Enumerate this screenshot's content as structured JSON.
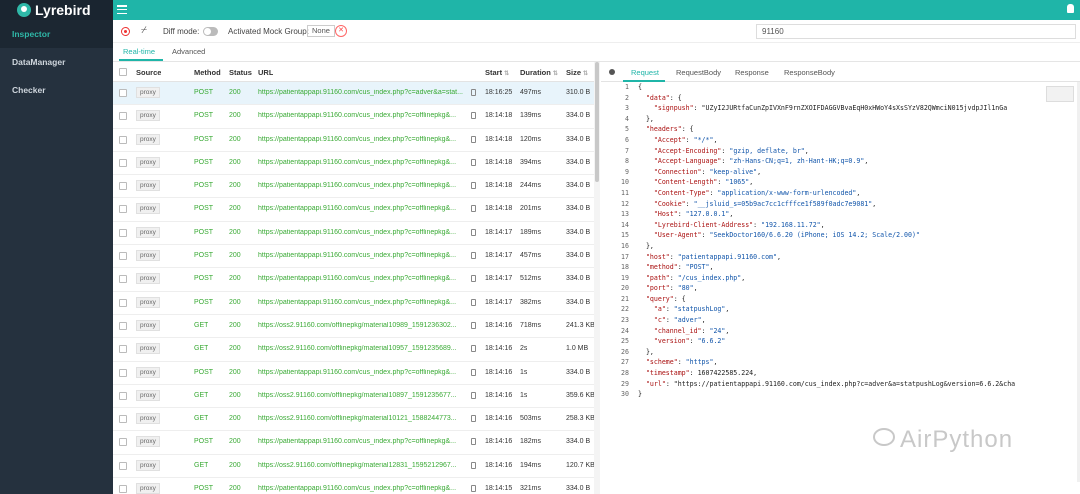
{
  "app": {
    "title": "Lyrebird"
  },
  "sidebar": {
    "items": [
      {
        "label": "Inspector"
      },
      {
        "label": "DataManager"
      },
      {
        "label": "Checker"
      }
    ]
  },
  "toolbar": {
    "diff_label": "Diff mode:",
    "mock_label": "Activated Mock Group:",
    "mock_value": "None",
    "search_value": "91160"
  },
  "tabs": [
    {
      "label": "Real-time"
    },
    {
      "label": "Advanced"
    }
  ],
  "list": {
    "headers": {
      "source": "Source",
      "method": "Method",
      "status": "Status",
      "url": "URL",
      "start": "Start",
      "duration": "Duration",
      "size": "Size"
    },
    "rows": [
      {
        "source": "proxy",
        "method": "POST",
        "status": "200",
        "url": "https://patientappapi.91160.com/cus_index.php?c=adver&a=stat...",
        "start": "18:16:25",
        "duration": "497ms",
        "size": "310.0 B"
      },
      {
        "source": "proxy",
        "method": "POST",
        "status": "200",
        "url": "https://patientappapi.91160.com/cus_index.php?c=offlinepkg&...",
        "start": "18:14:18",
        "duration": "139ms",
        "size": "334.0 B"
      },
      {
        "source": "proxy",
        "method": "POST",
        "status": "200",
        "url": "https://patientappapi.91160.com/cus_index.php?c=offlinepkg&...",
        "start": "18:14:18",
        "duration": "120ms",
        "size": "334.0 B"
      },
      {
        "source": "proxy",
        "method": "POST",
        "status": "200",
        "url": "https://patientappapi.91160.com/cus_index.php?c=offlinepkg&...",
        "start": "18:14:18",
        "duration": "394ms",
        "size": "334.0 B"
      },
      {
        "source": "proxy",
        "method": "POST",
        "status": "200",
        "url": "https://patientappapi.91160.com/cus_index.php?c=offlinepkg&...",
        "start": "18:14:18",
        "duration": "244ms",
        "size": "334.0 B"
      },
      {
        "source": "proxy",
        "method": "POST",
        "status": "200",
        "url": "https://patientappapi.91160.com/cus_index.php?c=offlinepkg&...",
        "start": "18:14:18",
        "duration": "201ms",
        "size": "334.0 B"
      },
      {
        "source": "proxy",
        "method": "POST",
        "status": "200",
        "url": "https://patientappapi.91160.com/cus_index.php?c=offlinepkg&...",
        "start": "18:14:17",
        "duration": "189ms",
        "size": "334.0 B"
      },
      {
        "source": "proxy",
        "method": "POST",
        "status": "200",
        "url": "https://patientappapi.91160.com/cus_index.php?c=offlinepkg&...",
        "start": "18:14:17",
        "duration": "457ms",
        "size": "334.0 B"
      },
      {
        "source": "proxy",
        "method": "POST",
        "status": "200",
        "url": "https://patientappapi.91160.com/cus_index.php?c=offlinepkg&...",
        "start": "18:14:17",
        "duration": "512ms",
        "size": "334.0 B"
      },
      {
        "source": "proxy",
        "method": "POST",
        "status": "200",
        "url": "https://patientappapi.91160.com/cus_index.php?c=offlinepkg&...",
        "start": "18:14:17",
        "duration": "382ms",
        "size": "334.0 B"
      },
      {
        "source": "proxy",
        "method": "GET",
        "status": "200",
        "url": "https://oss2.91160.com/offlinepkg/material10989_1591236302...",
        "start": "18:14:16",
        "duration": "718ms",
        "size": "241.3 KB"
      },
      {
        "source": "proxy",
        "method": "GET",
        "status": "200",
        "url": "https://oss2.91160.com/offlinepkg/material10957_1591235689...",
        "start": "18:14:16",
        "duration": "2s",
        "size": "1.0 MB"
      },
      {
        "source": "proxy",
        "method": "POST",
        "status": "200",
        "url": "https://patientappapi.91160.com/cus_index.php?c=offlinepkg&...",
        "start": "18:14:16",
        "duration": "1s",
        "size": "334.0 B"
      },
      {
        "source": "proxy",
        "method": "GET",
        "status": "200",
        "url": "https://oss2.91160.com/offlinepkg/material10897_1591235677...",
        "start": "18:14:16",
        "duration": "1s",
        "size": "359.6 KB"
      },
      {
        "source": "proxy",
        "method": "GET",
        "status": "200",
        "url": "https://oss2.91160.com/offlinepkg/material10121_1588244773...",
        "start": "18:14:16",
        "duration": "503ms",
        "size": "258.3 KB"
      },
      {
        "source": "proxy",
        "method": "POST",
        "status": "200",
        "url": "https://patientappapi.91160.com/cus_index.php?c=offlinepkg&...",
        "start": "18:14:16",
        "duration": "182ms",
        "size": "334.0 B"
      },
      {
        "source": "proxy",
        "method": "GET",
        "status": "200",
        "url": "https://oss2.91160.com/offlinepkg/material12831_1595212967...",
        "start": "18:14:16",
        "duration": "194ms",
        "size": "120.7 KB"
      },
      {
        "source": "proxy",
        "method": "POST",
        "status": "200",
        "url": "https://patientappapi.91160.com/cus_index.php?c=offlinepkg&...",
        "start": "18:14:15",
        "duration": "321ms",
        "size": "334.0 B"
      }
    ]
  },
  "detail": {
    "tabs": [
      {
        "label": "Request"
      },
      {
        "label": "RequestBody"
      },
      {
        "label": "Response"
      },
      {
        "label": "ResponseBody"
      }
    ],
    "code_lines": [
      "{",
      "  \"data\": {",
      "    \"signpush\": \"UZyI2JURtfaCunZpIVXnF9rnZXOIFDAGGVBvaEqH0xHWoY4sXsSYzV82QWmciN015jvdpJIl1nGa",
      "  },",
      "  \"headers\": {",
      "    \"Accept\": \"*/*\",",
      "    \"Accept-Encoding\": \"gzip, deflate, br\",",
      "    \"Accept-Language\": \"zh-Hans-CN;q=1, zh-Hant-HK;q=0.9\",",
      "    \"Connection\": \"keep-alive\",",
      "    \"Content-Length\": \"1065\",",
      "    \"Content-Type\": \"application/x-www-form-urlencoded\",",
      "    \"Cookie\": \"__jsluid_s=05b9ac7cc1cfffce1f589f0adc7e9081\",",
      "    \"Host\": \"127.0.0.1\",",
      "    \"Lyrebird-Client-Address\": \"192.168.11.72\",",
      "    \"User-Agent\": \"SeekDoctor160/6.6.20 (iPhone; iOS 14.2; Scale/2.00)\"",
      "  },",
      "  \"host\": \"patientappapi.91160.com\",",
      "  \"method\": \"POST\",",
      "  \"path\": \"/cus_index.php\",",
      "  \"port\": \"80\",",
      "  \"query\": {",
      "    \"a\": \"statpushLog\",",
      "    \"c\": \"adver\",",
      "    \"channel_id\": \"24\",",
      "    \"version\": \"6.6.2\"",
      "  },",
      "  \"scheme\": \"https\",",
      "  \"timestamp\": 1607422585.224,",
      "  \"url\": \"https://patientappapi.91160.com/cus_index.php?c=adver&a=statpushLog&version=6.6.2&cha",
      "}"
    ]
  },
  "watermark": {
    "text": "AirPython"
  },
  "colors": {
    "accent": "#1fb5a8",
    "sidebar": "#25313e",
    "green": "#3aaa35"
  }
}
